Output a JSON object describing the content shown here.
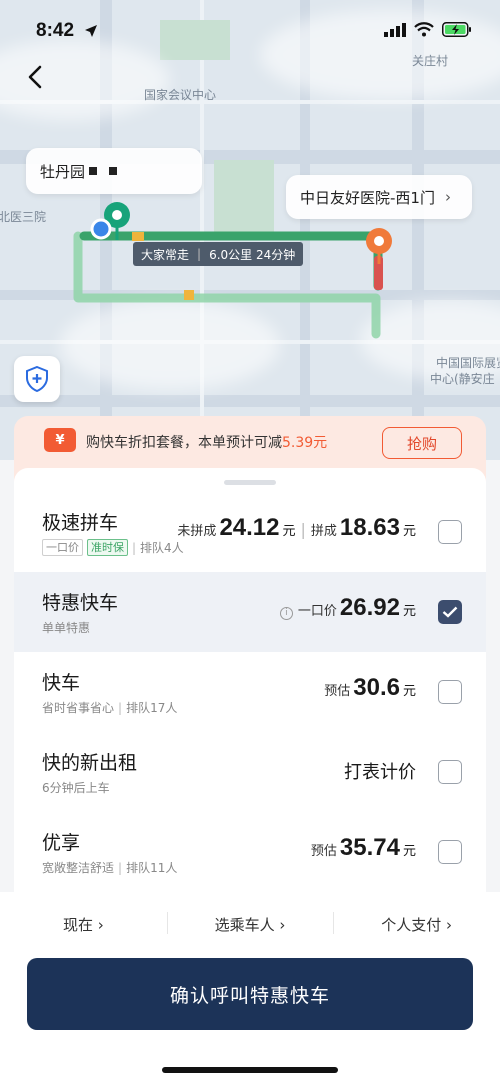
{
  "status": {
    "time": "8:42"
  },
  "map": {
    "labels": [
      "国家会议中心",
      "关庄村",
      "北医三院",
      "中国国际展览",
      "中心(静安庄"
    ],
    "start_label": "牡丹园",
    "destination": "中日友好医院-西1门",
    "route_tag": {
      "name": "大家常走",
      "info": "6.0公里 24分钟"
    }
  },
  "promo": {
    "icon": "¥",
    "text_prefix": "购快车折扣套餐，本单预计可减",
    "discount": "5.39元",
    "button": "抢购"
  },
  "rides": [
    {
      "title": "极速拼车",
      "tags": [
        "一口价",
        "准时保"
      ],
      "sub": "排队4人",
      "price_label_1": "未拼成",
      "price_1": "24.12",
      "unit_1": "元",
      "price_label_2": "拼成",
      "price_2": "18.63",
      "unit_2": "元",
      "selected": false
    },
    {
      "title": "特惠快车",
      "sub": "单单特惠",
      "price_label": "一口价",
      "price": "26.92",
      "unit": "元",
      "selected": true
    },
    {
      "title": "快车",
      "sub": "省时省事省心",
      "queue": "排队17人",
      "price_label": "预估",
      "price": "30.6",
      "unit": "元",
      "selected": false
    },
    {
      "title": "快的新出租",
      "sub": "6分钟后上车",
      "price_text": "打表计价",
      "selected": false
    },
    {
      "title": "优享",
      "sub": "宽敞整洁舒适",
      "queue": "排队11人",
      "price_label": "预估",
      "price": "35.74",
      "unit": "元",
      "selected": false
    }
  ],
  "options": [
    {
      "label": "现在 ›"
    },
    {
      "label": "选乘车人 ›"
    },
    {
      "label": "个人支付 ›"
    }
  ],
  "confirm_label": "确认呼叫特惠快车",
  "colors": {
    "accent": "#1c3358",
    "promo": "#f25b34",
    "route": "#3aa36b"
  }
}
